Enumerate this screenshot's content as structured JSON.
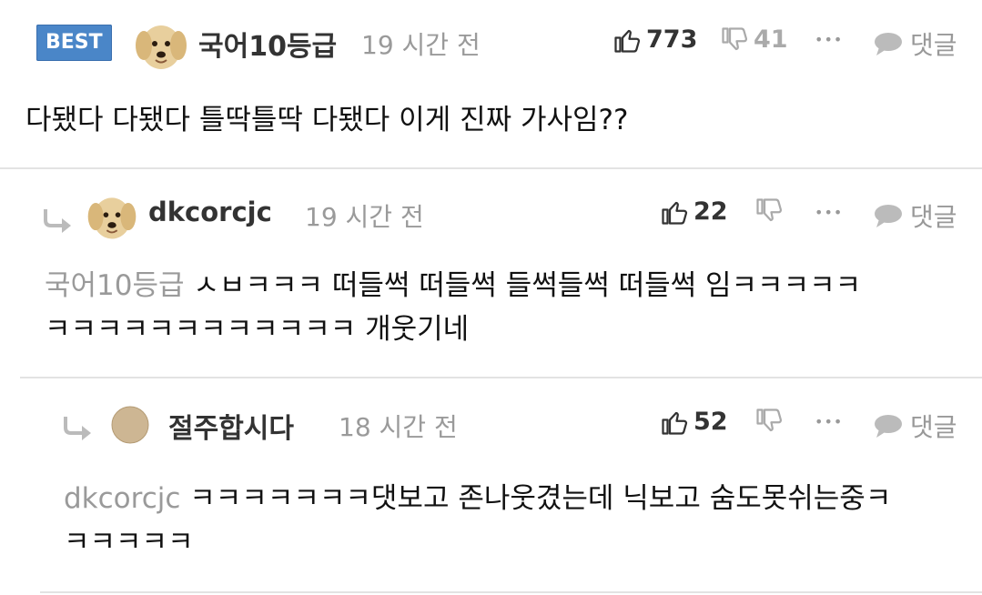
{
  "comments": [
    {
      "badge": "BEST",
      "username": "국어10등급",
      "time": "19 시간 전",
      "likes": "773",
      "dislikes": "41",
      "more": "•••",
      "reply_label": "댓글",
      "text": "다됐다 다됐다 틀딱틀딱 다됐다 이게 진짜 가사임??"
    },
    {
      "username": "dkcorcjc",
      "time": "19 시간 전",
      "likes": "22",
      "more": "•••",
      "reply_label": "댓글",
      "mention": "국어10등급",
      "text_line1": "ㅅㅂㅋㅋㅋ 떠들썩 떠들썩 들썩들썩 떠들썩 임ㅋㅋㅋㅋㅋ",
      "text_line2": "ㅋㅋㅋㅋㅋㅋㅋㅋㅋㅋㅋㅋ 개웃기네"
    },
    {
      "username": "절주합시다",
      "time": "18 시간 전",
      "likes": "52",
      "more": "•••",
      "reply_label": "댓글",
      "mention": "dkcorcjc",
      "text_line1": "ㅋㅋㅋㅋㅋㅋㅋ댓보고 존나웃겼는데 닉보고 숨도못쉬는중ㅋ",
      "text_line2": "ㅋㅋㅋㅋㅋ"
    }
  ],
  "icons": {
    "like": "thumbs-up-icon",
    "dislike": "thumbs-down-icon",
    "reply": "speech-bubble-icon",
    "indent": "reply-arrow-icon"
  },
  "colors": {
    "best_badge": "#4a86c8",
    "muted": "#9a9a9a",
    "divider": "#e3e3e3"
  }
}
